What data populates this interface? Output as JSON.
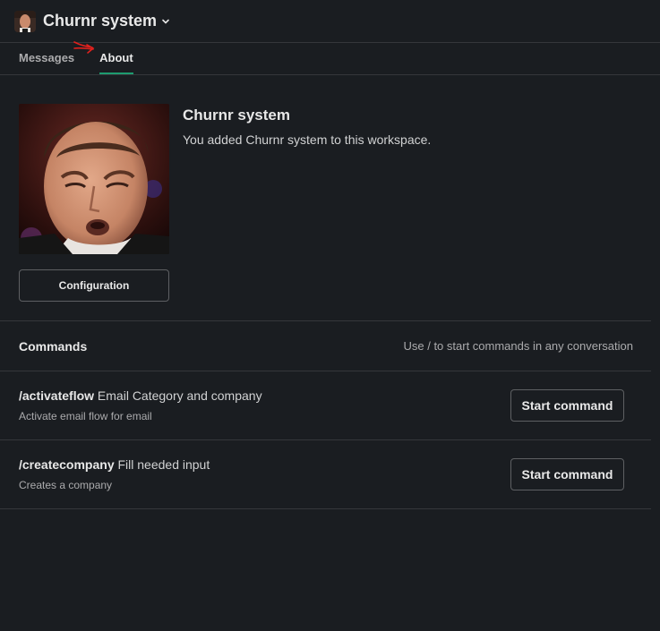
{
  "header": {
    "title": "Churnr system",
    "chevron_icon": "chevron-down-icon"
  },
  "tabs": [
    {
      "label": "Messages",
      "active": false
    },
    {
      "label": "About",
      "active": true
    }
  ],
  "profile": {
    "name": "Churnr system",
    "description": "You added Churnr system to this workspace.",
    "config_label": "Configuration"
  },
  "commands": {
    "title": "Commands",
    "hint": "Use / to start commands in any conversation",
    "items": [
      {
        "name": "/activateflow",
        "args": " Email Category and company",
        "desc": "Activate email flow for email",
        "button": "Start command"
      },
      {
        "name": "/createcompany",
        "args": " Fill needed input",
        "desc": "Creates a company",
        "button": "Start command"
      }
    ]
  },
  "colors": {
    "accent": "#1d9b6f",
    "background": "#1a1d21",
    "annotation_arrow": "#e0211d"
  }
}
